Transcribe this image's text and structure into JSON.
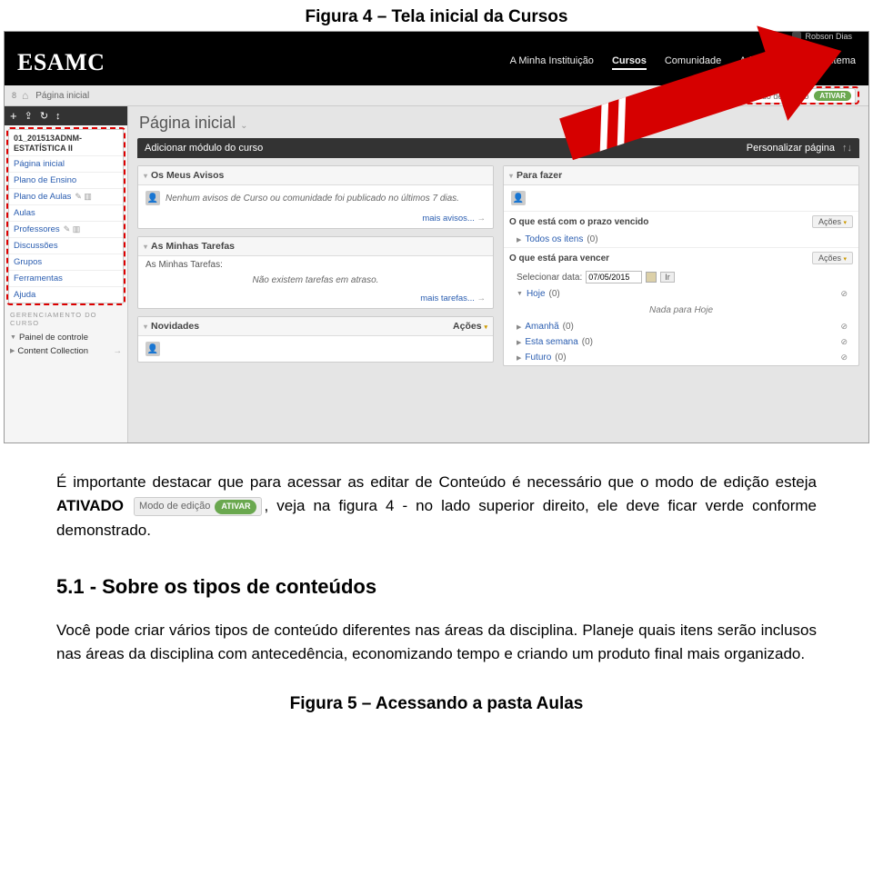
{
  "caption_top": "Figura 4 – Tela inicial da Cursos",
  "shot": {
    "user_name": "Robson Dias",
    "logo": "ESAMC",
    "nav": [
      "A Minha Instituição",
      "Cursos",
      "Comunidade",
      "Administração do Sistema"
    ],
    "nav_active_index": 1,
    "breadcrumb": "Página inicial",
    "counter": "8",
    "edit_pill": {
      "label": "Modo de edição",
      "button": "ATIVAR"
    },
    "sidebar": {
      "course_title": "01_201513ADNM-ESTATÍSTICA II",
      "items": [
        {
          "label": "Página inicial",
          "icons": ""
        },
        {
          "label": "Plano de Ensino",
          "icons": ""
        },
        {
          "label": "Plano de Aulas",
          "icons": "✎ ▥"
        },
        {
          "label": "Aulas",
          "icons": ""
        },
        {
          "label": "Professores",
          "icons": "✎ ▥"
        },
        {
          "label": "Discussões",
          "icons": ""
        },
        {
          "label": "Grupos",
          "icons": ""
        },
        {
          "label": "Ferramentas",
          "icons": ""
        },
        {
          "label": "Ajuda",
          "icons": ""
        }
      ],
      "mgmt_header": "GERENCIAMENTO DO CURSO",
      "mgmt_items": [
        "Painel de controle",
        "Content Collection"
      ]
    },
    "page_title": "Página inicial",
    "blackbar": {
      "left": "Adicionar módulo do curso",
      "right": "Personalizar página"
    },
    "left_panels": {
      "avisos": {
        "title": "Os Meus Avisos",
        "body": "Nenhum avisos de Curso ou comunidade foi publicado no últimos 7 dias.",
        "foot": "mais avisos..."
      },
      "tarefas": {
        "title": "As Minhas Tarefas",
        "sub": "As Minhas Tarefas:",
        "body": "Não existem tarefas em atraso.",
        "foot": "mais tarefas..."
      },
      "novidades": {
        "title": "Novidades",
        "actions": "Ações"
      }
    },
    "right_panels": {
      "parafazer": {
        "title": "Para fazer"
      },
      "vencido": {
        "title": "O que está com o prazo vencido",
        "all_items": "Todos os itens",
        "count": "(0)",
        "actions": "Ações"
      },
      "vencer": {
        "title": "O que está para vencer",
        "actions": "Ações",
        "select_label": "Selecionar data:",
        "date_value": "07/05/2015",
        "ir": "Ir",
        "rows": [
          {
            "label": "Hoje",
            "count": "(0)",
            "empty": "Nada para Hoje"
          },
          {
            "label": "Amanhã",
            "count": "(0)"
          },
          {
            "label": "Esta semana",
            "count": "(0)"
          },
          {
            "label": "Futuro",
            "count": "(0)"
          }
        ]
      }
    }
  },
  "body_text": {
    "p1_a": "É importante destacar que para acessar as editar de Conteúdo é necessário que o modo de edição esteja ",
    "p1_bold": "ATIVADO",
    "p1_b": ", veja na figura 4 - no lado superior direito, ele deve ficar verde conforme demonstrado.",
    "inline_pill": {
      "label": "Modo de edição",
      "button": "ATIVAR"
    },
    "h2": "5.1 - Sobre os tipos de conteúdos",
    "p2": "Você pode criar vários tipos de conteúdo diferentes nas áreas da disciplina. Planeje quais itens serão inclusos nas áreas da disciplina com antecedência, economizando tempo e criando um produto final mais organizado.",
    "caption_bottom": "Figura 5 – Acessando a pasta Aulas"
  }
}
